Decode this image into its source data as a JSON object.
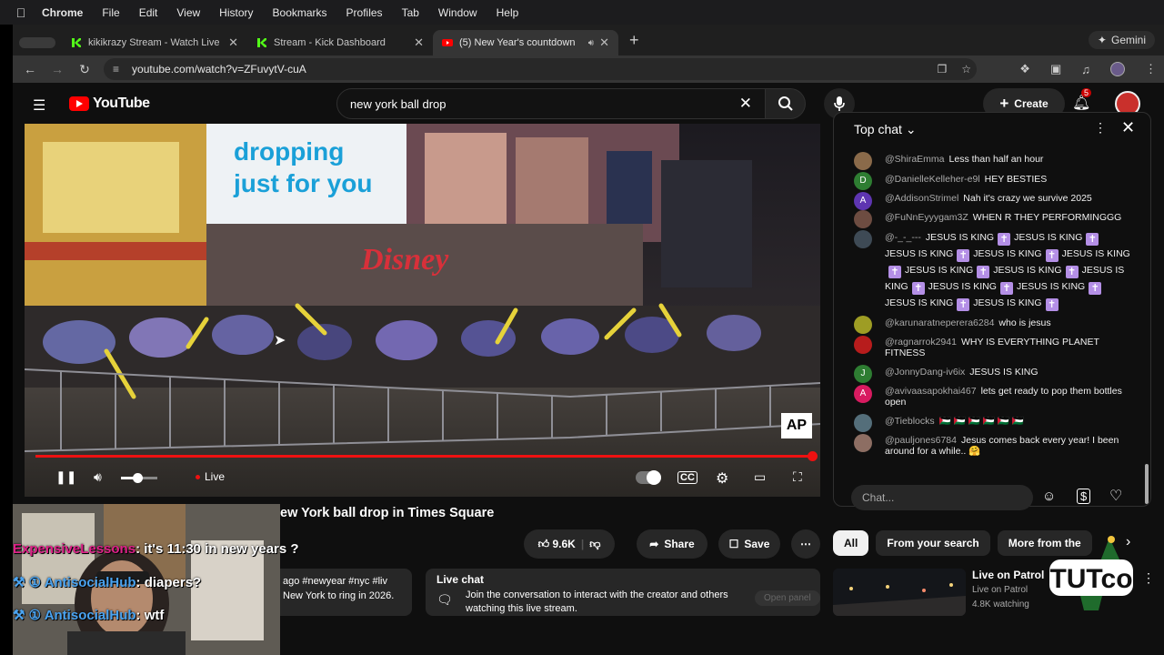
{
  "menubar": {
    "items": [
      "Chrome",
      "File",
      "Edit",
      "View",
      "History",
      "Bookmarks",
      "Profiles",
      "Tab",
      "Window",
      "Help"
    ]
  },
  "tabs": [
    {
      "title": "kikikrazy Stream - Watch Live",
      "favicon_color": "#53fc18"
    },
    {
      "title": "Stream - Kick Dashboard",
      "favicon_color": "#53fc18"
    },
    {
      "title": "(5) New Year's countdown",
      "favicon_color": "#ff0000"
    }
  ],
  "gemini_label": "Gemini",
  "address": {
    "url": "youtube.com/watch?v=ZFuvytV-cuA"
  },
  "youtube": {
    "logo_text": "YouTube",
    "search_value": "new york ball drop",
    "create_label": "Create",
    "notifications": "5"
  },
  "player": {
    "live_label": "Live",
    "ap_label": "AP",
    "progress": 1.0,
    "volume": 0.45,
    "billboard_text": "dropping just for you",
    "store_text": "Disney"
  },
  "chat": {
    "header": "Top chat",
    "placeholder": "Chat...",
    "messages": [
      {
        "author": "@ShiraEmma",
        "text": "Less than half an hour",
        "avatar_color": "#8a6a4a",
        "initial": ""
      },
      {
        "author": "@DanielleKelleher-e9l",
        "text": "HEY BESTIES",
        "avatar_color": "#2e7d32",
        "initial": "D"
      },
      {
        "author": "@AddisonStrimel",
        "text": "Nah it's crazy we survive 2025",
        "avatar_color": "#5e35b1",
        "initial": "A"
      },
      {
        "author": "@FuNnEyyygam3Z",
        "text": "WHEN R THEY PERFORMINGGG",
        "avatar_color": "#6d4c41",
        "initial": ""
      },
      {
        "author": "@-_-_---",
        "text": "JESUS IS KING",
        "avatar_color": "#3e4a55",
        "initial": "",
        "repeat": 12
      },
      {
        "author": "@karunaratneperera6284",
        "text": "who is jesus",
        "avatar_color": "#9e9d24",
        "initial": ""
      },
      {
        "author": "@ragnarrok2941",
        "text": "WHY IS EVERYTHING PLANET FITNESS",
        "avatar_color": "#b71c1c",
        "initial": ""
      },
      {
        "author": "@JonnyDang-iv6ix",
        "text": "JESUS IS KING",
        "avatar_color": "#2e7d32",
        "initial": "J"
      },
      {
        "author": "@avivaasapokhai467",
        "text": "lets get ready to pop them bottles open",
        "avatar_color": "#d81b60",
        "initial": "A"
      },
      {
        "author": "@Tieblocks",
        "text": "🇵🇸 🇵🇸 🇵🇸 🇵🇸 🇵🇸 🇵🇸",
        "avatar_color": "#546e7a",
        "initial": ""
      },
      {
        "author": "@pauljones6784",
        "text": "Jesus comes back every year! I been around for a while.. 🤗",
        "avatar_color": "#8d6e63",
        "initial": ""
      }
    ]
  },
  "video": {
    "title": "ew York ball drop in Times Square",
    "likes": "9.6K",
    "share_label": "Share",
    "save_label": "Save",
    "desc_line1": "ago  #newyear #nyc #liv",
    "desc_line2": "New York to ring in 2026.",
    "live_chat_title": "Live chat",
    "live_chat_text": "Join the conversation to interact with the creator and others watching this live stream.",
    "open_panel": "Open panel"
  },
  "overlay_chat": [
    {
      "user": "ExpensiveLessons",
      "text": ": it's 11:30 in new years ?",
      "color": "#e0218a"
    },
    {
      "user": "AntisocialHub",
      "text": ": diapers?",
      "color": "#4aa3f0"
    },
    {
      "user": "AntisocialHub",
      "text": ": wtf",
      "color": "#4aa3f0"
    }
  ],
  "chips": [
    "All",
    "From your search",
    "More from the"
  ],
  "recommended": {
    "title": "Live on Patrol",
    "channel": "Live on Patrol",
    "watching": "4.8K watching"
  },
  "tutco": {
    "text": "TUTco"
  }
}
